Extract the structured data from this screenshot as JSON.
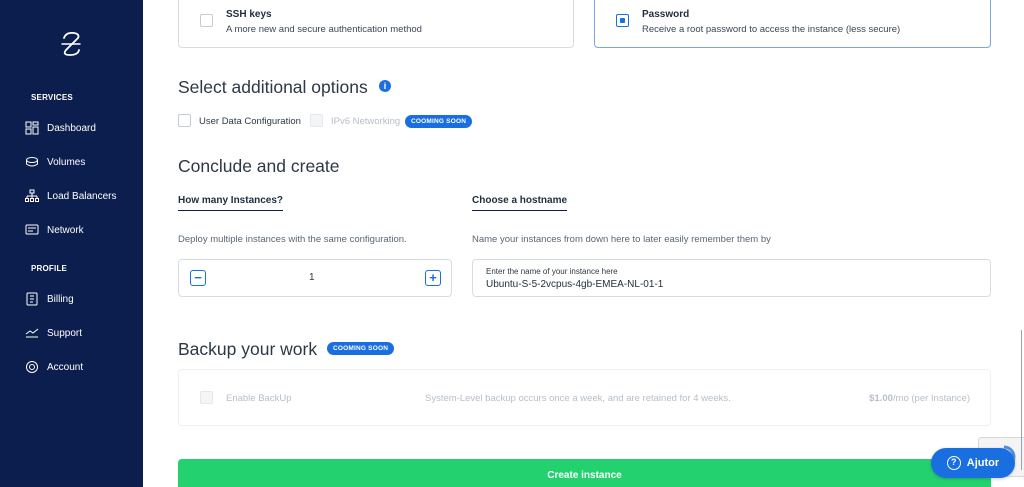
{
  "sidebar": {
    "services_label": "SERVICES",
    "services": [
      {
        "label": "Dashboard",
        "icon": "dashboard-icon"
      },
      {
        "label": "Volumes",
        "icon": "volumes-icon"
      },
      {
        "label": "Load Balancers",
        "icon": "load-balancers-icon"
      },
      {
        "label": "Network",
        "icon": "network-icon"
      }
    ],
    "profile_label": "PROFILE",
    "profile": [
      {
        "label": "Billing",
        "icon": "billing-icon"
      },
      {
        "label": "Support",
        "icon": "support-icon"
      },
      {
        "label": "Account",
        "icon": "account-icon"
      }
    ]
  },
  "auth": {
    "ssh": {
      "title": "SSH keys",
      "desc": "A more new and secure authentication method",
      "checked": false
    },
    "password": {
      "title": "Password",
      "desc": "Receive a root password to access the instance (less secure)",
      "checked": true
    }
  },
  "additional": {
    "title": "Select additional options",
    "info_glyph": "i",
    "options": [
      {
        "label": "User Data Configuration",
        "enabled": true
      },
      {
        "label": "IPv6 Networking",
        "enabled": false
      }
    ],
    "badge": "COOMING SOON"
  },
  "conclude": {
    "title": "Conclude and create",
    "instances": {
      "heading": "How many Instances?",
      "hint": "Deploy multiple instances with the same configuration.",
      "value": "1",
      "minus": "−",
      "plus": "+"
    },
    "hostname": {
      "heading": "Choose a hostname",
      "hint": "Name your instances from down here to later easily remember them by",
      "label": "Enter the name of your instance here",
      "value": "Ubuntu-S-5-2vcpus-4gb-EMEA-NL-01-1"
    }
  },
  "backup": {
    "title": "Backup your work",
    "badge": "COOMING SOON",
    "enable_label": "Enable BackUp",
    "desc": "System-Level backup occurs once a week, and are retained for 4 weeks.",
    "price": "$1.00",
    "price_unit": "/mo (per Instance)"
  },
  "create_label": "Create instance",
  "help_label": "Ajutor",
  "help_glyph": "?",
  "colors": {
    "sidebar": "#0b1e4d",
    "accent": "#1a6fe0",
    "create": "#23d16f"
  }
}
